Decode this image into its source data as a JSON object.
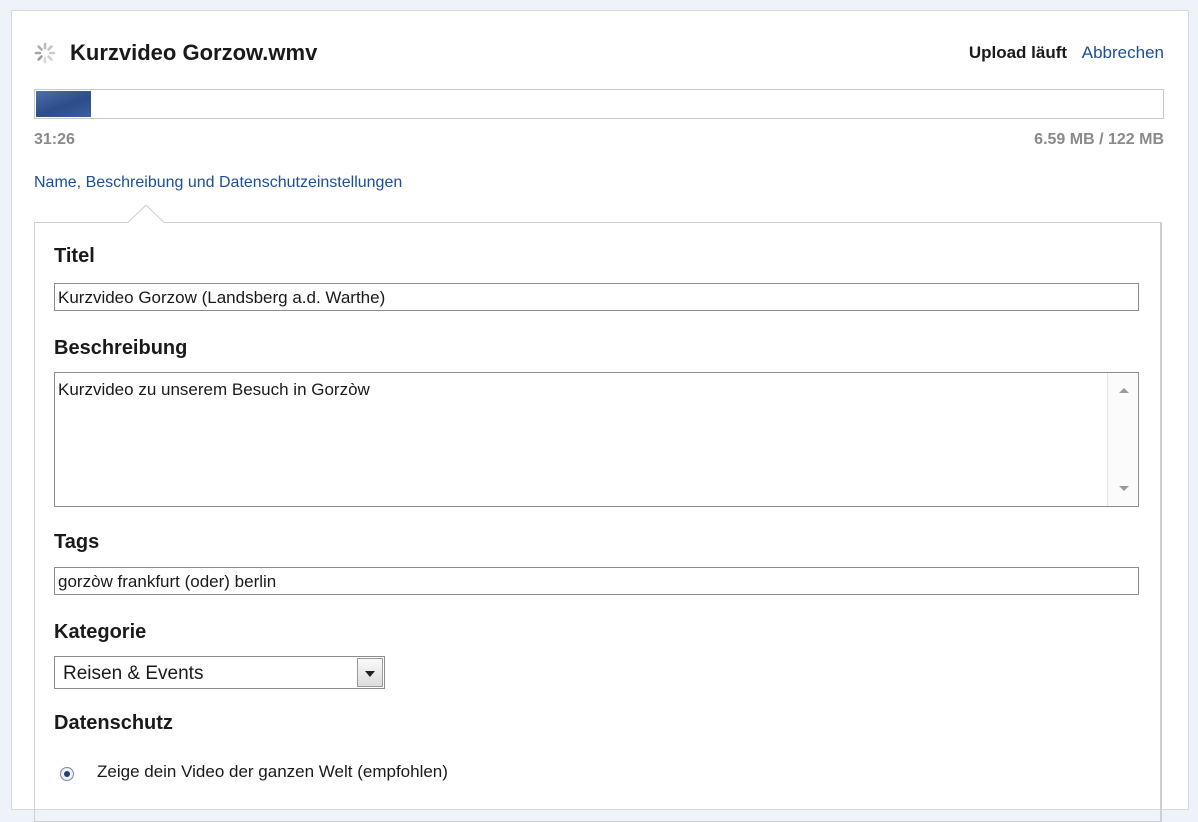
{
  "upload": {
    "filename": "Kurzvideo Gorzow.wmv",
    "status": "Upload läuft",
    "cancel_label": "Abbrechen",
    "progress": 0.049,
    "elapsed": "31:26",
    "size_text": "6.59 MB / 122 MB"
  },
  "section_link": "Name, Beschreibung und Datenschutzeinstellungen",
  "form": {
    "title_label": "Titel",
    "title_value": "Kurzvideo Gorzow (Landsberg a.d. Warthe)",
    "description_label": "Beschreibung",
    "description_value": "Kurzvideo zu unserem Besuch in Gorzòw",
    "tags_label": "Tags",
    "tags_value": "gorzòw frankfurt (oder) berlin",
    "category_label": "Kategorie",
    "category_value": "Reisen & Events",
    "privacy_label": "Datenschutz",
    "privacy_option": "Zeige dein Video der ganzen Welt (empfohlen)"
  },
  "colors": {
    "link": "#1c4ea0",
    "progress": "#2c4c8a",
    "background": "#eef2f9"
  }
}
